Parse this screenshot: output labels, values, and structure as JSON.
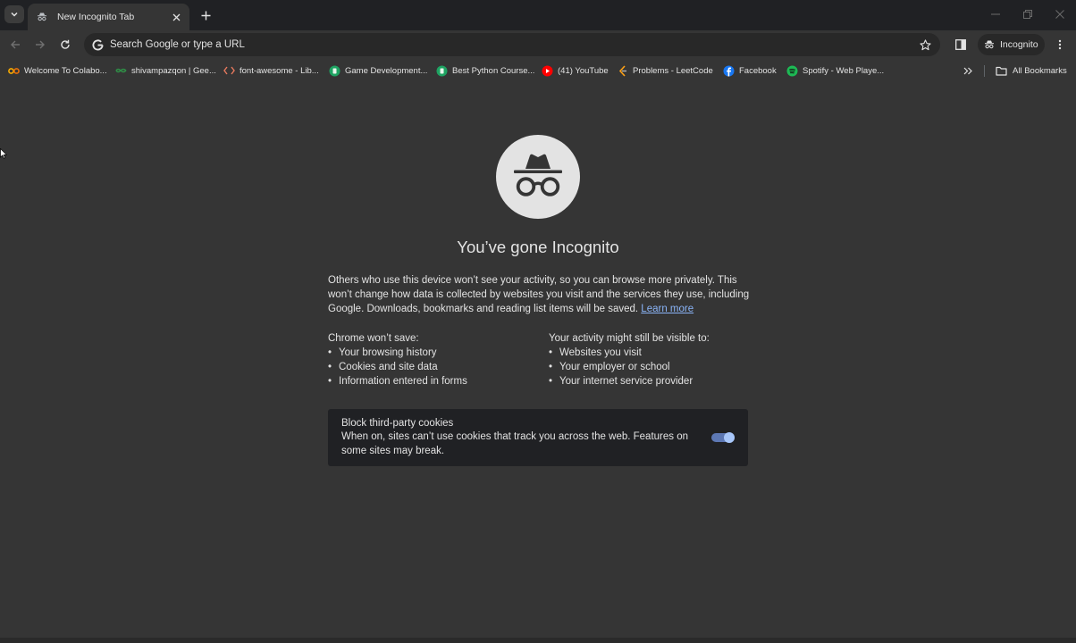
{
  "tab": {
    "title": "New Incognito Tab"
  },
  "omnibox": {
    "placeholder": "Search Google or type a URL"
  },
  "profile": {
    "label": "Incognito"
  },
  "bookmarks": [
    {
      "label": "Welcome To Colabo...",
      "icon": "colab-icon",
      "color": "#f9ab00"
    },
    {
      "label": "shivampazqon | Gee...",
      "icon": "geeksforgeeks-icon",
      "color": "#2f8d46"
    },
    {
      "label": "font-awesome - Lib...",
      "icon": "code-icon",
      "color": "#e8795e"
    },
    {
      "label": "Game Development...",
      "icon": "green-book-icon",
      "color": "#1ea362"
    },
    {
      "label": "Best Python Course...",
      "icon": "green-book-icon",
      "color": "#1ea362"
    },
    {
      "label": "(41) YouTube",
      "icon": "youtube-icon",
      "color": "#ff0000"
    },
    {
      "label": "Problems - LeetCode",
      "icon": "leetcode-icon",
      "color": "#ffa116"
    },
    {
      "label": "Facebook",
      "icon": "facebook-icon",
      "color": "#1877f2"
    },
    {
      "label": "Spotify - Web Playe...",
      "icon": "spotify-icon",
      "color": "#1db954"
    }
  ],
  "all_bookmarks": {
    "label": "All Bookmarks"
  },
  "main": {
    "headline": "You’ve gone Incognito",
    "intro": "Others who use this device won’t see your activity, so you can browse more privately. This won’t change how data is collected by websites you visit and the services they use, including Google. Downloads, bookmarks and reading list items will be saved.",
    "learn_more": "Learn more",
    "wont_save": {
      "title": "Chrome won’t save:",
      "items": [
        "Your browsing history",
        "Cookies and site data",
        "Information entered in forms"
      ]
    },
    "visible_to": {
      "title": "Your activity might still be visible to:",
      "items": [
        "Websites you visit",
        "Your employer or school",
        "Your internet service provider"
      ]
    },
    "cookies": {
      "title": "Block third-party cookies",
      "description": "When on, sites can’t use cookies that track you across the web. Features on some sites may break.",
      "enabled": true
    }
  },
  "colors": {
    "accent": "#8ab4f8",
    "toggle_track": "#5d78b4",
    "page_bg": "#353535"
  }
}
